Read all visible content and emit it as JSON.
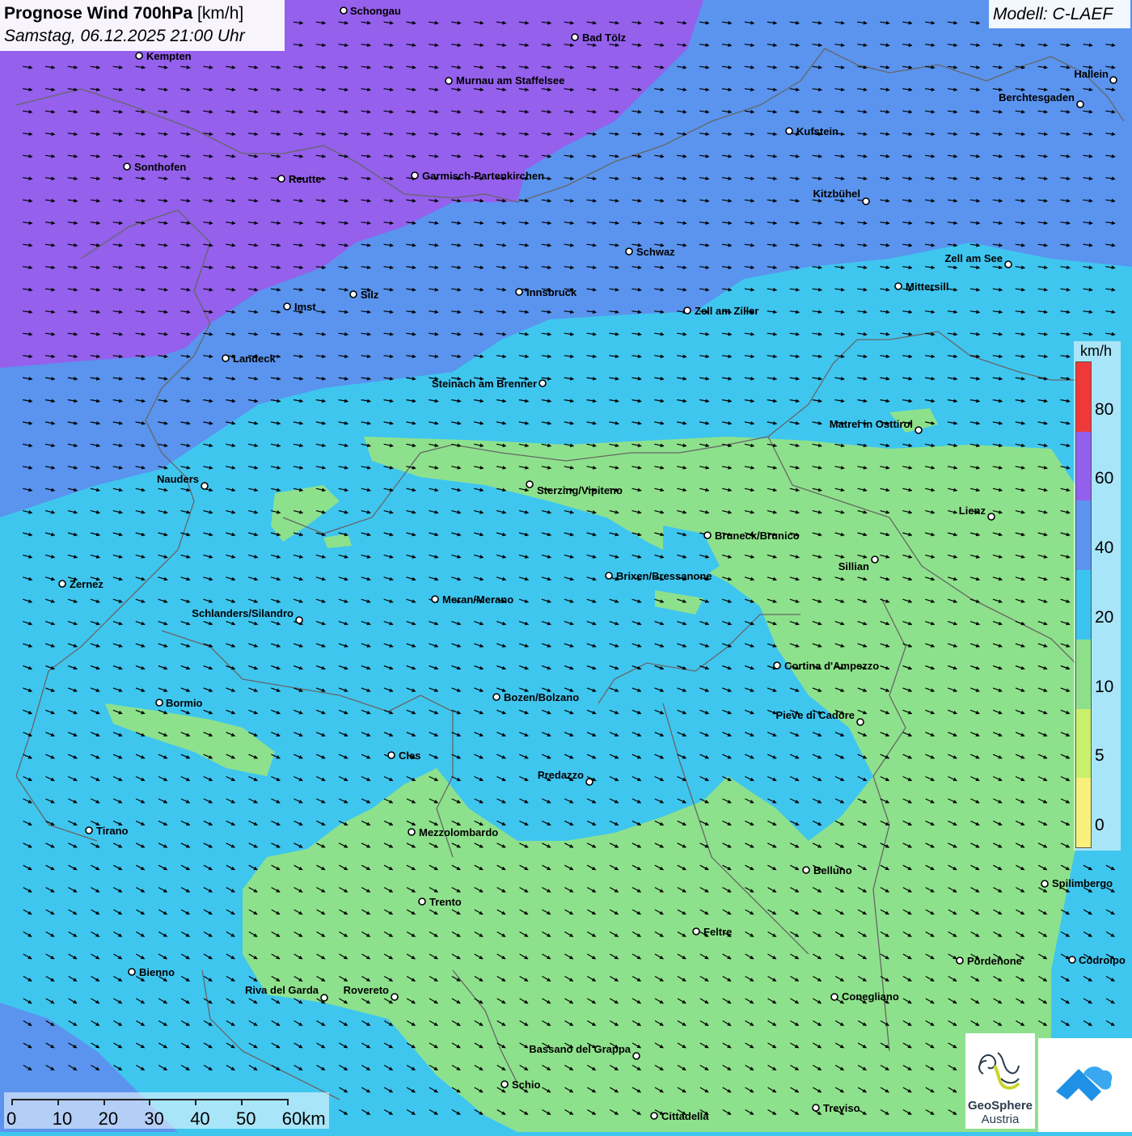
{
  "header": {
    "title_bold": "Prognose Wind 700hPa",
    "title_unit": " [km/h]",
    "subtitle": "Samstag, 06.12.2025 21:00 Uhr",
    "model": "Modell: C-LAEF"
  },
  "legend": {
    "unit": "km/h",
    "steps": [
      {
        "label": "80",
        "color": "#f03838"
      },
      {
        "label": "60",
        "color": "#9360ee"
      },
      {
        "label": "40",
        "color": "#5b94ee"
      },
      {
        "label": "20",
        "color": "#3cc4f0"
      },
      {
        "label": "10",
        "color": "#8de08a"
      },
      {
        "label": "5",
        "color": "#c8f06a"
      },
      {
        "label": "0",
        "color": "#f7f07a"
      }
    ]
  },
  "scale": {
    "labels": [
      "0",
      "10",
      "20",
      "30",
      "40",
      "50",
      "60km"
    ]
  },
  "logos": {
    "geosphere_line1": "GeoSphere",
    "geosphere_line2": "Austria"
  },
  "cities": [
    {
      "name": "Schongau"
    },
    {
      "name": "Bad Tölz"
    },
    {
      "name": "Kempten"
    },
    {
      "name": "Murnau am Staffelsee"
    },
    {
      "name": "Hallein"
    },
    {
      "name": "Berchtesgaden"
    },
    {
      "name": "Kufstein"
    },
    {
      "name": "Sonthofen"
    },
    {
      "name": "Reutte"
    },
    {
      "name": "Garmisch-Partenkirchen"
    },
    {
      "name": "Kitzbühel"
    },
    {
      "name": "Schwaz"
    },
    {
      "name": "Zell am See"
    },
    {
      "name": "Innsbruck"
    },
    {
      "name": "Mittersill"
    },
    {
      "name": "Silz"
    },
    {
      "name": "Imst"
    },
    {
      "name": "Zell am Ziller"
    },
    {
      "name": "Landeck"
    },
    {
      "name": "Steinach am Brenner"
    },
    {
      "name": "Matrei in Osttirol"
    },
    {
      "name": "Nauders"
    },
    {
      "name": "Sterzing/Vipiteno"
    },
    {
      "name": "Lienz"
    },
    {
      "name": "Bruneck/Brunico"
    },
    {
      "name": "Sillian"
    },
    {
      "name": "Brixen/Bressanone"
    },
    {
      "name": "Zernez"
    },
    {
      "name": "Meran/Merano"
    },
    {
      "name": "Schlanders/Silandro"
    },
    {
      "name": "Cortina d'Ampezzo"
    },
    {
      "name": "Bozen/Bolzano"
    },
    {
      "name": "Bormio"
    },
    {
      "name": "Pieve di Cadore"
    },
    {
      "name": "Cles"
    },
    {
      "name": "Predazzo"
    },
    {
      "name": "Tirano"
    },
    {
      "name": "Mezzolombardo"
    },
    {
      "name": "Belluno"
    },
    {
      "name": "Spilimbergo"
    },
    {
      "name": "Trento"
    },
    {
      "name": "Feltre"
    },
    {
      "name": "Bienno"
    },
    {
      "name": "Pordenone"
    },
    {
      "name": "Codroipo"
    },
    {
      "name": "Riva del Garda"
    },
    {
      "name": "Rovereto"
    },
    {
      "name": "Conegliano"
    },
    {
      "name": "Bassano del Grappa"
    },
    {
      "name": "Schio"
    },
    {
      "name": "Treviso"
    },
    {
      "name": "Cittadella"
    }
  ]
}
